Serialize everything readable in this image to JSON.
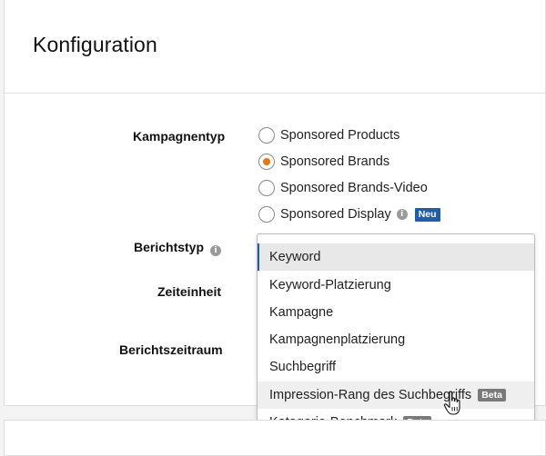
{
  "card": {
    "title": "Konfiguration"
  },
  "labels": {
    "campaign_type": "Kampagnentyp",
    "report_type": "Berichtstyp",
    "time_unit": "Zeiteinheit",
    "report_period": "Berichtszeitraum"
  },
  "campaign_types": [
    {
      "label": "Sponsored Products",
      "checked": false
    },
    {
      "label": "Sponsored Brands",
      "checked": true
    },
    {
      "label": "Sponsored Brands-Video",
      "checked": false
    },
    {
      "label": "Sponsored Display",
      "checked": false,
      "badge": "Neu"
    }
  ],
  "report_dropdown": {
    "options": [
      {
        "label": "Keyword",
        "state": "selected"
      },
      {
        "label": "Keyword-Platzierung"
      },
      {
        "label": "Kampagne"
      },
      {
        "label": "Kampagnenplatzierung"
      },
      {
        "label": "Suchbegriff"
      },
      {
        "label": "Impression-Rang des Suchbegriffs",
        "badge": "Beta",
        "state": "hover"
      },
      {
        "label": "Kategorie-Benchmark",
        "badge": "Beta"
      }
    ]
  },
  "colors": {
    "accent": "#e47911",
    "badge_new": "#1f5fa8",
    "badge_beta": "#7a7a7a"
  },
  "icons": {
    "info": "info-icon",
    "cursor": "hand-cursor-icon"
  }
}
